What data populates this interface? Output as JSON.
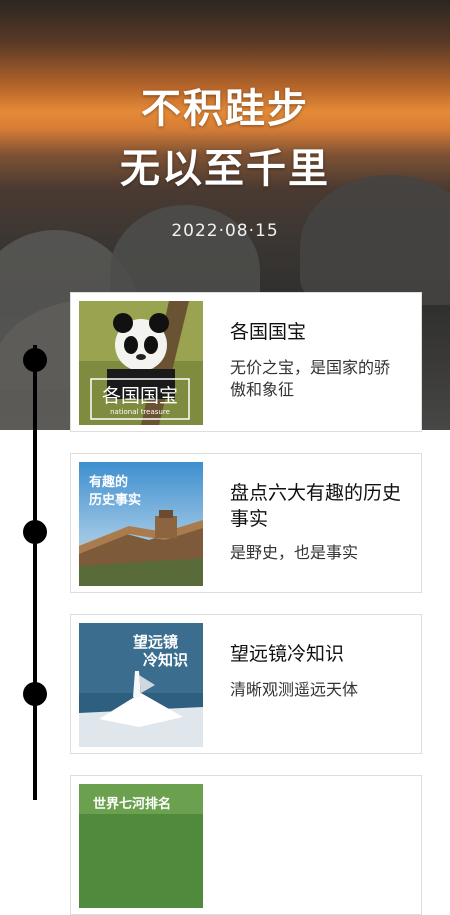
{
  "hero": {
    "title_line1": "不积跬步",
    "title_line2": "无以至千里",
    "date": "2022·08·15"
  },
  "cards": [
    {
      "title": "各国国宝",
      "subtitle": "无价之宝，是国家的骄傲和象征",
      "thumb_text": "各国国宝",
      "thumb_sub": "national treasure"
    },
    {
      "title": "盘点六大有趣的历史事实",
      "subtitle": "是野史，也是事实",
      "thumb_text": "有趣的历史事实"
    },
    {
      "title": "望远镜冷知识",
      "subtitle": "清晰观测遥远天体",
      "thumb_text": "望远镜冷知识"
    },
    {
      "title": "",
      "subtitle": "",
      "thumb_text": "世界七河排名"
    }
  ],
  "colors": {
    "timeline": "#000000",
    "card_border": "#dedede"
  }
}
